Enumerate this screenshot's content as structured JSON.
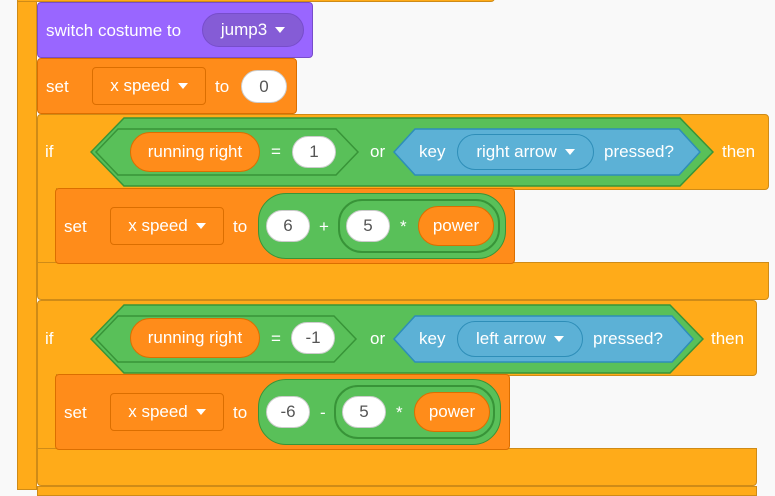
{
  "looks": {
    "switch_label": "switch costume to",
    "costume": "jump3"
  },
  "set1": {
    "set": "set",
    "var": "x speed",
    "to": "to",
    "value": "0"
  },
  "if1": {
    "if": "if",
    "then": "then",
    "cond_var": "running right",
    "eq": "=",
    "eq_value": "1",
    "or": "or",
    "key": "key",
    "key_choice": "right arrow",
    "pressed": "pressed?",
    "body": {
      "set": "set",
      "var": "x speed",
      "to": "to",
      "a": "6",
      "plus": "+",
      "b": "5",
      "times": "*",
      "power": "power"
    }
  },
  "if2": {
    "if": "if",
    "then": "then",
    "cond_var": "running right",
    "eq": "=",
    "eq_value": "-1",
    "or": "or",
    "key": "key",
    "key_choice": "left arrow",
    "pressed": "pressed?",
    "body": {
      "set": "set",
      "var": "x speed",
      "to": "to",
      "a": "-6",
      "minus": "-",
      "b": "5",
      "times": "*",
      "power": "power"
    }
  },
  "colors": {
    "control": "#ffab19",
    "variables": "#ff8c1a",
    "looks": "#9966ff",
    "operators": "#59c059",
    "sensing": "#5cb1d6"
  }
}
